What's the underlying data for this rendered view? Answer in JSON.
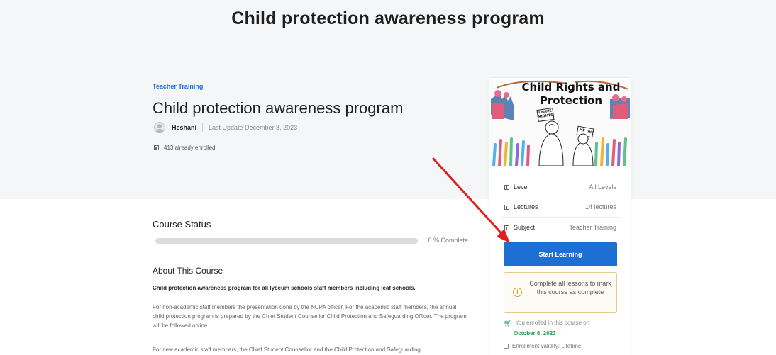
{
  "header": {
    "title": "Child protection awareness program"
  },
  "course": {
    "category": "Teacher Training",
    "title": "Child protection awareness program",
    "author": "Heshani",
    "last_update": "Last Update December 8, 2023",
    "enrolled_count": "413 already enrolled"
  },
  "status": {
    "title": "Course Status",
    "progress_percent": 0,
    "progress_label": "0 % Complete"
  },
  "about": {
    "title": "About This Course",
    "lead": "Child protection awareness program for all lyceum schools staff members including leaf schools.",
    "paragraph_1": "For non-academic staff members the presentation done by the NCPA officer. For the academic staff members, the annual child protection program is prepared by the Chief Student Counsellor Child Protection and Safeguarding Officer. The program will be followed online.",
    "paragraph_2": "For new academic staff members, the Chief Student Counsellor and the Child Protection and Safeguarding"
  },
  "sidebar": {
    "thumbnail": {
      "title": "Child Rights and Protection",
      "sign_1": "I HAVE RIGHTS",
      "sign_2": "ME too"
    },
    "specs": [
      {
        "label": "Level",
        "value": "All Levels"
      },
      {
        "label": "Lectures",
        "value": "14 lectures"
      },
      {
        "label": "Subject",
        "value": "Teacher Training"
      }
    ],
    "start_button": "Start Learning",
    "notice": "Complete all lessons to mark this course as complete",
    "enrolled_on": "You enrolled in this course on",
    "enrolled_date": "October 8, 2023",
    "validity": "Enrollment validity: Lifetime"
  },
  "colors": {
    "accent": "#1d6fd3",
    "success": "#1f9d55",
    "warning": "#d9a32a",
    "annotation_arrow": "#e02020"
  },
  "icons": [
    "user-avatar-icon",
    "tag-icon",
    "alert-circle-icon",
    "cart-icon",
    "calendar-icon",
    "arrow-annotation"
  ]
}
